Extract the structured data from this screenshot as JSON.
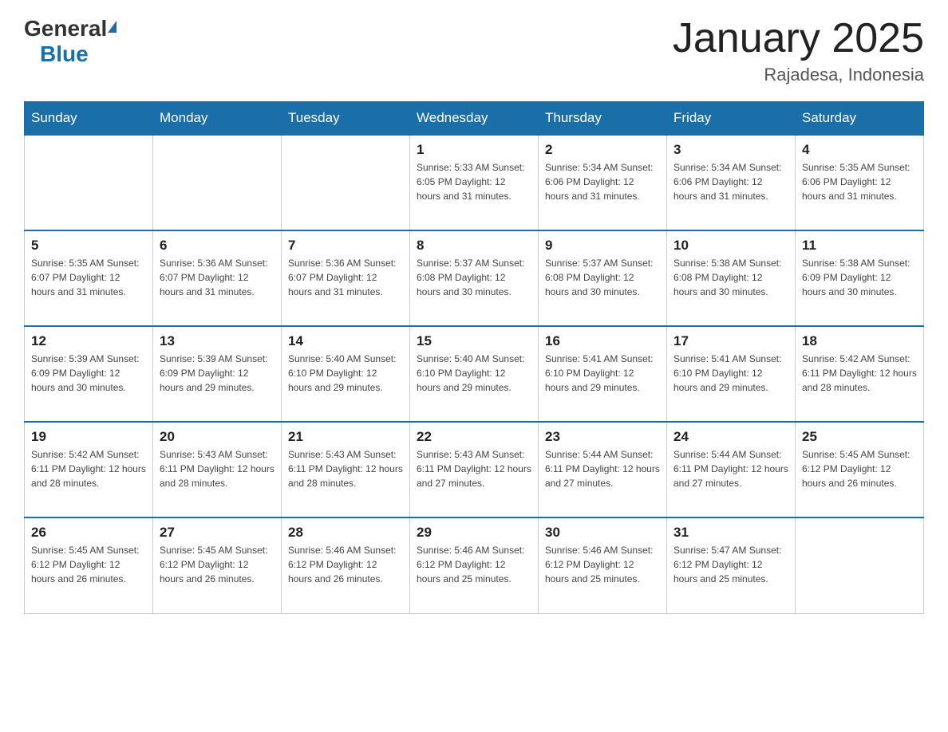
{
  "header": {
    "logo_general": "General",
    "logo_blue": "Blue",
    "title": "January 2025",
    "subtitle": "Rajadesa, Indonesia"
  },
  "weekdays": [
    "Sunday",
    "Monday",
    "Tuesday",
    "Wednesday",
    "Thursday",
    "Friday",
    "Saturday"
  ],
  "weeks": [
    [
      {
        "day": "",
        "info": ""
      },
      {
        "day": "",
        "info": ""
      },
      {
        "day": "",
        "info": ""
      },
      {
        "day": "1",
        "info": "Sunrise: 5:33 AM\nSunset: 6:05 PM\nDaylight: 12 hours\nand 31 minutes."
      },
      {
        "day": "2",
        "info": "Sunrise: 5:34 AM\nSunset: 6:06 PM\nDaylight: 12 hours\nand 31 minutes."
      },
      {
        "day": "3",
        "info": "Sunrise: 5:34 AM\nSunset: 6:06 PM\nDaylight: 12 hours\nand 31 minutes."
      },
      {
        "day": "4",
        "info": "Sunrise: 5:35 AM\nSunset: 6:06 PM\nDaylight: 12 hours\nand 31 minutes."
      }
    ],
    [
      {
        "day": "5",
        "info": "Sunrise: 5:35 AM\nSunset: 6:07 PM\nDaylight: 12 hours\nand 31 minutes."
      },
      {
        "day": "6",
        "info": "Sunrise: 5:36 AM\nSunset: 6:07 PM\nDaylight: 12 hours\nand 31 minutes."
      },
      {
        "day": "7",
        "info": "Sunrise: 5:36 AM\nSunset: 6:07 PM\nDaylight: 12 hours\nand 31 minutes."
      },
      {
        "day": "8",
        "info": "Sunrise: 5:37 AM\nSunset: 6:08 PM\nDaylight: 12 hours\nand 30 minutes."
      },
      {
        "day": "9",
        "info": "Sunrise: 5:37 AM\nSunset: 6:08 PM\nDaylight: 12 hours\nand 30 minutes."
      },
      {
        "day": "10",
        "info": "Sunrise: 5:38 AM\nSunset: 6:08 PM\nDaylight: 12 hours\nand 30 minutes."
      },
      {
        "day": "11",
        "info": "Sunrise: 5:38 AM\nSunset: 6:09 PM\nDaylight: 12 hours\nand 30 minutes."
      }
    ],
    [
      {
        "day": "12",
        "info": "Sunrise: 5:39 AM\nSunset: 6:09 PM\nDaylight: 12 hours\nand 30 minutes."
      },
      {
        "day": "13",
        "info": "Sunrise: 5:39 AM\nSunset: 6:09 PM\nDaylight: 12 hours\nand 29 minutes."
      },
      {
        "day": "14",
        "info": "Sunrise: 5:40 AM\nSunset: 6:10 PM\nDaylight: 12 hours\nand 29 minutes."
      },
      {
        "day": "15",
        "info": "Sunrise: 5:40 AM\nSunset: 6:10 PM\nDaylight: 12 hours\nand 29 minutes."
      },
      {
        "day": "16",
        "info": "Sunrise: 5:41 AM\nSunset: 6:10 PM\nDaylight: 12 hours\nand 29 minutes."
      },
      {
        "day": "17",
        "info": "Sunrise: 5:41 AM\nSunset: 6:10 PM\nDaylight: 12 hours\nand 29 minutes."
      },
      {
        "day": "18",
        "info": "Sunrise: 5:42 AM\nSunset: 6:11 PM\nDaylight: 12 hours\nand 28 minutes."
      }
    ],
    [
      {
        "day": "19",
        "info": "Sunrise: 5:42 AM\nSunset: 6:11 PM\nDaylight: 12 hours\nand 28 minutes."
      },
      {
        "day": "20",
        "info": "Sunrise: 5:43 AM\nSunset: 6:11 PM\nDaylight: 12 hours\nand 28 minutes."
      },
      {
        "day": "21",
        "info": "Sunrise: 5:43 AM\nSunset: 6:11 PM\nDaylight: 12 hours\nand 28 minutes."
      },
      {
        "day": "22",
        "info": "Sunrise: 5:43 AM\nSunset: 6:11 PM\nDaylight: 12 hours\nand 27 minutes."
      },
      {
        "day": "23",
        "info": "Sunrise: 5:44 AM\nSunset: 6:11 PM\nDaylight: 12 hours\nand 27 minutes."
      },
      {
        "day": "24",
        "info": "Sunrise: 5:44 AM\nSunset: 6:11 PM\nDaylight: 12 hours\nand 27 minutes."
      },
      {
        "day": "25",
        "info": "Sunrise: 5:45 AM\nSunset: 6:12 PM\nDaylight: 12 hours\nand 26 minutes."
      }
    ],
    [
      {
        "day": "26",
        "info": "Sunrise: 5:45 AM\nSunset: 6:12 PM\nDaylight: 12 hours\nand 26 minutes."
      },
      {
        "day": "27",
        "info": "Sunrise: 5:45 AM\nSunset: 6:12 PM\nDaylight: 12 hours\nand 26 minutes."
      },
      {
        "day": "28",
        "info": "Sunrise: 5:46 AM\nSunset: 6:12 PM\nDaylight: 12 hours\nand 26 minutes."
      },
      {
        "day": "29",
        "info": "Sunrise: 5:46 AM\nSunset: 6:12 PM\nDaylight: 12 hours\nand 25 minutes."
      },
      {
        "day": "30",
        "info": "Sunrise: 5:46 AM\nSunset: 6:12 PM\nDaylight: 12 hours\nand 25 minutes."
      },
      {
        "day": "31",
        "info": "Sunrise: 5:47 AM\nSunset: 6:12 PM\nDaylight: 12 hours\nand 25 minutes."
      },
      {
        "day": "",
        "info": ""
      }
    ]
  ]
}
